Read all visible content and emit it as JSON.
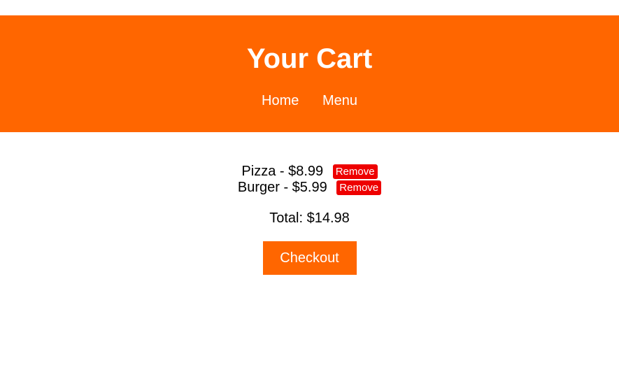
{
  "colors": {
    "accent": "#ff6600",
    "remove": "#ee0000",
    "header_text": "#ffffff"
  },
  "header": {
    "title": "Your Cart",
    "nav": [
      "Home",
      "Menu"
    ]
  },
  "cart": {
    "items": [
      {
        "label": "Pizza - $8.99",
        "remove_label": "Remove"
      },
      {
        "label": "Burger - $5.99",
        "remove_label": "Remove"
      }
    ],
    "total": "Total: $14.98",
    "checkout_label": "Checkout"
  }
}
